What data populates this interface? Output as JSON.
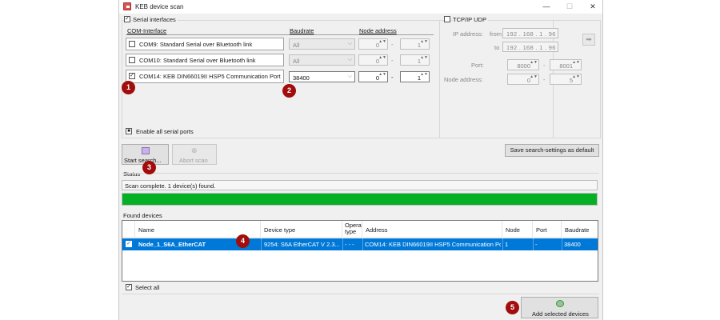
{
  "window": {
    "title": "KEB device scan",
    "min_glyph": "—",
    "max_glyph": "☐",
    "close_glyph": "✕"
  },
  "serial": {
    "group_label": "Serial interfaces",
    "checked": true,
    "headers": {
      "interface": "COM-Interface",
      "baudrate": "Baudrate",
      "node_address": "Node address"
    },
    "rows": [
      {
        "label": "COM9: Standard Serial over Bluetooth link",
        "checked": false,
        "baud": "All",
        "node_from": "0",
        "node_to": "1"
      },
      {
        "label": "COM10: Standard Serial over Bluetooth link",
        "checked": false,
        "baud": "All",
        "node_from": "0",
        "node_to": "1"
      },
      {
        "label": "COM14: KEB DIN66019II HSP5 Communication Port",
        "checked": true,
        "baud": "38400",
        "node_from": "0",
        "node_to": "1"
      }
    ],
    "dash": "-",
    "enable_all_label": "Enable all serial ports"
  },
  "tcp": {
    "group_label": "TCP/IP UDP",
    "checked": false,
    "ip_label": "IP address:",
    "from_label": "from",
    "to_label": "to",
    "ip_from": "192 . 168 .   1   .  96",
    "ip_to": "192 . 168 .   1   .  96",
    "port_label": "Port:",
    "port_from": "8000",
    "port_to": "8001",
    "node_label": "Node address:",
    "node_from": "0",
    "node_to": "5",
    "dash": "-",
    "arrow_glyph": "➡"
  },
  "buttons": {
    "start_search": "Start search...",
    "abort_scan": "Abort scan",
    "save_settings": "Save search-settings as default",
    "add_devices": "Add selected devices"
  },
  "status": {
    "label": "Status",
    "text": "Scan complete. 1 device(s) found.",
    "progress_percent": 100,
    "progress_color": "#06b025"
  },
  "found": {
    "label": "Found devices",
    "columns": {
      "name": "Name",
      "device_type": "Device type",
      "opera": "Opera",
      "type": "type",
      "address": "Address",
      "node": "Node",
      "port": "Port",
      "baudrate": "Baudrate"
    },
    "row": {
      "checked": true,
      "name": "Node_1_S6A_EtherCAT",
      "device_type": "9254: S6A EtherCAT V 2.3....",
      "opera": "- - -",
      "address": "COM14: KEB DIN66019II HSP5 Communication Port",
      "node": "1",
      "port": "-",
      "baudrate": "38400"
    },
    "select_all_label": "Select all",
    "select_all_checked": true,
    "selection_color": "#0078d7"
  },
  "badges": [
    "1",
    "2",
    "3",
    "4",
    "5"
  ],
  "badge_color": "#a10d0d",
  "glyphs": {
    "check": "✓",
    "square": "■",
    "chevron": "⌵",
    "spin": "▲▼",
    "scan_icon": "⊗"
  }
}
